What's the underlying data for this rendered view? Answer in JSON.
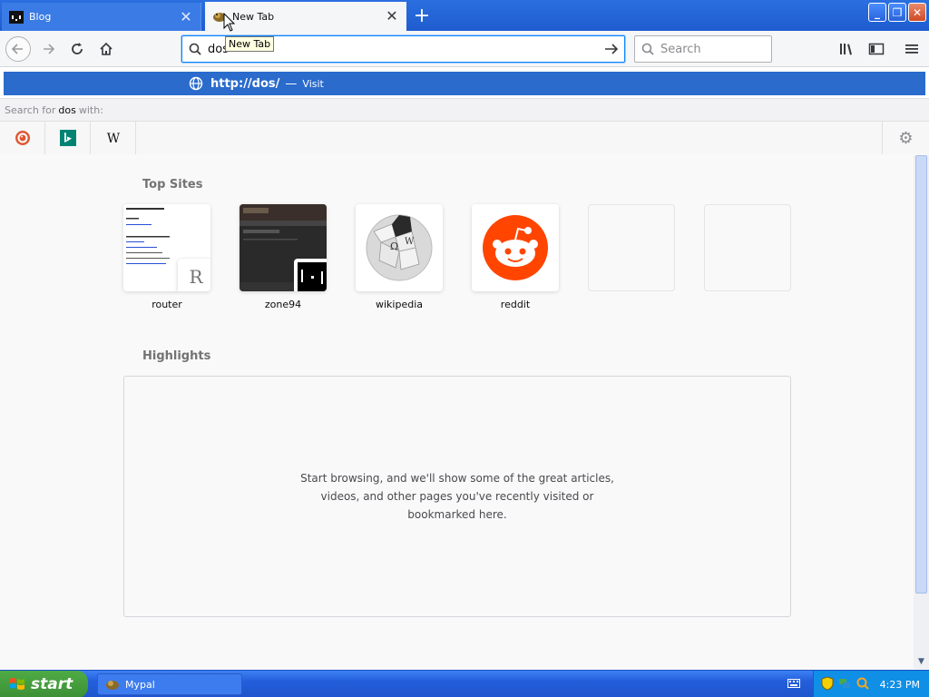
{
  "tabs": [
    {
      "title": "Blog",
      "active": false,
      "icon": "terminal-favicon"
    },
    {
      "title": "New Tab",
      "active": true,
      "icon": "mypal-favicon"
    }
  ],
  "tooltip": "New Tab",
  "navbar": {
    "url_value": "dos",
    "search_placeholder": "Search"
  },
  "autocomplete": {
    "suggestion_url": "http://dos/",
    "suggestion_separator": "—",
    "suggestion_action": "Visit",
    "search_for_prefix": "Search for",
    "search_for_term": "dos",
    "search_for_suffix": "with:",
    "engines": [
      "duckduckgo-icon",
      "bing-icon",
      "wikipedia-icon"
    ]
  },
  "top_sites": {
    "title": "Top Sites",
    "sites": [
      {
        "label": "router",
        "badge": "R"
      },
      {
        "label": "zone94"
      },
      {
        "label": "wikipedia"
      },
      {
        "label": "reddit"
      },
      {
        "label": ""
      },
      {
        "label": ""
      }
    ]
  },
  "highlights": {
    "title": "Highlights",
    "message": "Start browsing, and we'll show some of the great articles, videos, and other pages you've recently visited or bookmarked here."
  },
  "taskbar": {
    "start_label": "start",
    "task_label": "Mypal",
    "clock": "4:23 PM"
  },
  "colors": {
    "accent": "#0a84ff",
    "suggestion_bg": "#2a6bcc",
    "reddit": "#ff4500",
    "xp_blue": "#245edb",
    "xp_start": "#3c8f34"
  }
}
